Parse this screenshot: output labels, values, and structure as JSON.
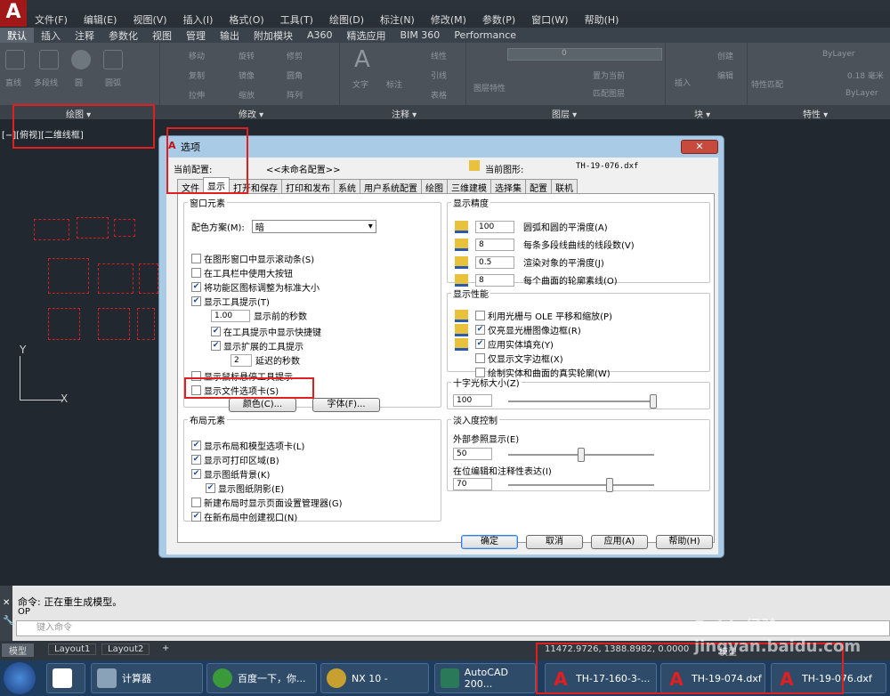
{
  "menu": [
    "文件(F)",
    "编辑(E)",
    "视图(V)",
    "插入(I)",
    "格式(O)",
    "工具(T)",
    "绘图(D)",
    "标注(N)",
    "修改(M)",
    "参数(P)",
    "窗口(W)",
    "帮助(H)"
  ],
  "ribbon_tabs": [
    "默认",
    "插入",
    "注释",
    "参数化",
    "视图",
    "管理",
    "输出",
    "附加模块",
    "A360",
    "精选应用",
    "BIM 360",
    "Performance"
  ],
  "ribbon": {
    "draw": [
      "直线",
      "多段线",
      "圆",
      "圆弧"
    ],
    "modify": [
      "移动",
      "旋转",
      "修剪",
      "复制",
      "镜像",
      "圆角",
      "拉伸",
      "缩放",
      "阵列"
    ],
    "annot": [
      "文字",
      "标注",
      "线性",
      "引线",
      "表格"
    ],
    "layer": [
      "图层特性",
      "置为当前",
      "匹配图层"
    ],
    "block": [
      "插入",
      "创建",
      "编辑"
    ],
    "props": [
      "特性匹配",
      "ByLayer",
      "0.18 毫米",
      "ByLayer"
    ],
    "layer_value": "0"
  },
  "panels": [
    "绘图 ▾",
    "修改 ▾",
    "注释 ▾",
    "图层 ▾",
    "块 ▾",
    "特性 ▾"
  ],
  "view_label": "[−][俯视][二维线框]",
  "ucs": {
    "x": "X",
    "y": "Y"
  },
  "dialog": {
    "title": "选项",
    "close": "✕",
    "profile_label": "当前配置:",
    "profile_value": "<<未命名配置>>",
    "drawing_label": "当前图形:",
    "drawing_value": "TH-19-076.dxf",
    "tabs": [
      "文件",
      "显示",
      "打开和保存",
      "打印和发布",
      "系统",
      "用户系统配置",
      "绘图",
      "三维建模",
      "选择集",
      "配置",
      "联机"
    ],
    "window": {
      "legend": "窗口元素",
      "scheme_label": "配色方案(M):",
      "scheme_value": "暗",
      "opts": [
        {
          "label": "在图形窗口中显示滚动条(S)",
          "checked": false
        },
        {
          "label": "在工具栏中使用大按钮",
          "checked": false
        },
        {
          "label": "将功能区图标调整为标准大小",
          "checked": true
        },
        {
          "label": "显示工具提示(T)",
          "checked": true
        }
      ],
      "delay_value": "1.00",
      "delay_label": "显示前的秒数",
      "sub": [
        {
          "label": "在工具提示中显示快捷键",
          "checked": true
        },
        {
          "label": "显示扩展的工具提示",
          "checked": true
        }
      ],
      "ext_value": "2",
      "ext_label": "延迟的秒数",
      "opts2": [
        {
          "label": "显示鼠标悬停工具提示",
          "checked": false
        },
        {
          "label": "显示文件选项卡(S)",
          "checked": false
        }
      ],
      "colors_btn": "颜色(C)...",
      "fonts_btn": "字体(F)..."
    },
    "layout": {
      "legend": "布局元素",
      "opts": [
        {
          "label": "显示布局和模型选项卡(L)",
          "checked": true
        },
        {
          "label": "显示可打印区域(B)",
          "checked": true
        },
        {
          "label": "显示图纸背景(K)",
          "checked": true
        },
        {
          "label": "显示图纸阴影(E)",
          "checked": true
        },
        {
          "label": "新建布局时显示页面设置管理器(G)",
          "checked": false
        },
        {
          "label": "在新布局中创建视口(N)",
          "checked": true
        }
      ]
    },
    "resolution": {
      "legend": "显示精度",
      "items": [
        {
          "value": "100",
          "label": "圆弧和圆的平滑度(A)"
        },
        {
          "value": "8",
          "label": "每条多段线曲线的线段数(V)"
        },
        {
          "value": "0.5",
          "label": "渲染对象的平滑度(J)"
        },
        {
          "value": "8",
          "label": "每个曲面的轮廓素线(O)"
        }
      ]
    },
    "performance": {
      "legend": "显示性能",
      "opts": [
        {
          "label": "利用光栅与 OLE 平移和缩放(P)",
          "checked": false
        },
        {
          "label": "仅亮显光栅图像边框(R)",
          "checked": true
        },
        {
          "label": "应用实体填充(Y)",
          "checked": true
        },
        {
          "label": "仅显示文字边框(X)",
          "checked": false
        },
        {
          "label": "绘制实体和曲面的真实轮廓(W)",
          "checked": false
        }
      ]
    },
    "crosshair": {
      "legend": "十字光标大小(Z)",
      "value": "100",
      "level": 1.0
    },
    "fade": {
      "legend": "淡入度控制",
      "xref_label": "外部参照显示(E)",
      "xref_value": "50",
      "xref_level": 0.5,
      "inplace_label": "在位编辑和注释性表达(I)",
      "inplace_value": "70",
      "inplace_level": 0.7
    },
    "buttons": {
      "ok": "确定",
      "cancel": "取消",
      "apply": "应用(A)",
      "help": "帮助(H)"
    }
  },
  "command": {
    "line1": "命令: 正在重生成模型。",
    "line2": "OP",
    "placeholder": "键入命令"
  },
  "layout_tabs": [
    "模型",
    "Layout1",
    "Layout2",
    "+"
  ],
  "coords": "11472.9726, 1388.8982, 0.0000",
  "model_label": "模型",
  "taskbar": [
    "计算器",
    "百度一下，你...",
    "NX 10 -",
    "AutoCAD 200...",
    "TH-17-160-3-...",
    "TH-19-074.dxf",
    "TH-19-076.dxf"
  ],
  "watermark": "Baidu经验 jingyan.baidu.com"
}
